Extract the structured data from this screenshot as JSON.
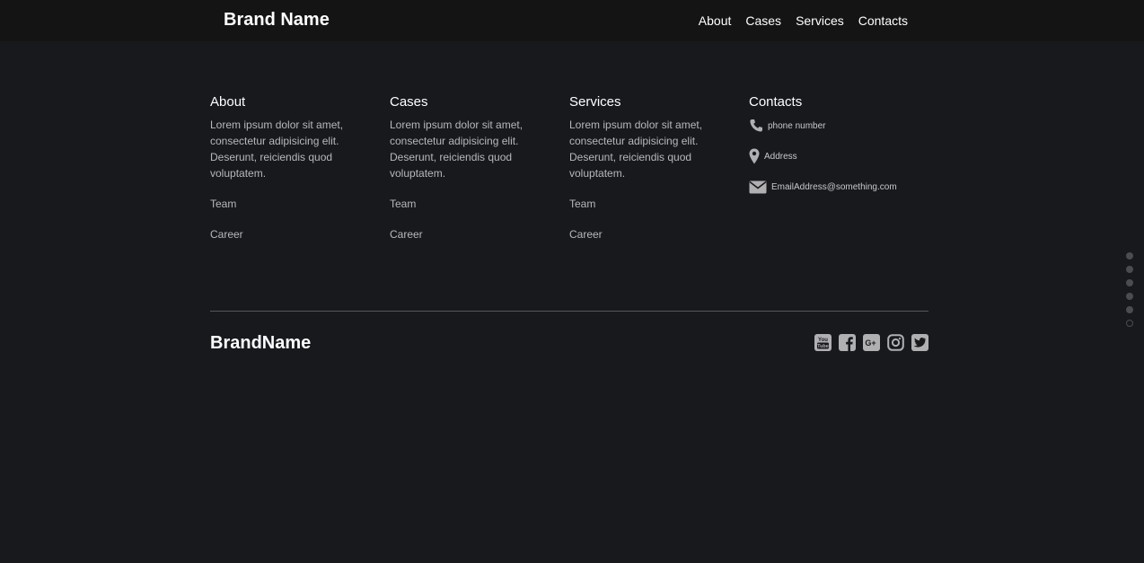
{
  "navbar": {
    "brand": "Brand Name",
    "links": [
      "About",
      "Cases",
      "Services",
      "Contacts"
    ]
  },
  "columns": [
    {
      "title": "About",
      "description": "Lorem ipsum dolor sit amet, consectetur adipisicing elit. Deserunt, reiciendis quod voluptatem.",
      "links": [
        "Team",
        "Career"
      ]
    },
    {
      "title": "Cases",
      "description": "Lorem ipsum dolor sit amet, consectetur adipisicing elit. Deserunt, reiciendis quod voluptatem.",
      "links": [
        "Team",
        "Career"
      ]
    },
    {
      "title": "Services",
      "description": "Lorem ipsum dolor sit amet, consectetur adipisicing elit. Deserunt, reiciendis quod voluptatem.",
      "links": [
        "Team",
        "Career"
      ]
    }
  ],
  "contacts": {
    "title": "Contacts",
    "phone": "phone number",
    "address": "Address",
    "email": "EmailAddress@something.com"
  },
  "footer": {
    "brand": "BrandName",
    "social_icons": [
      "youtube-icon",
      "facebook-icon",
      "google-plus-icon",
      "instagram-icon",
      "twitter-icon"
    ]
  },
  "page_dots": {
    "count": 6,
    "active_index": 5
  },
  "colors": {
    "background": "#17191d",
    "navbar": "#141414",
    "muted_text": "#b7b8ba",
    "icon": "#b0b0b2",
    "dot": "#4a4c52"
  }
}
